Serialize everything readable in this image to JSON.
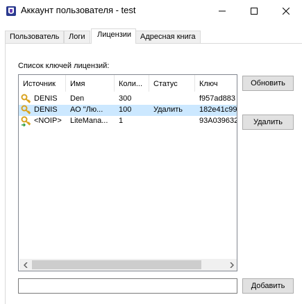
{
  "window": {
    "title": "Аккаунт пользователя - test",
    "icon": "app-shield-icon"
  },
  "tabs": [
    {
      "label": "Пользователь",
      "active": false
    },
    {
      "label": "Логи",
      "active": false
    },
    {
      "label": "Лицензии",
      "active": true
    },
    {
      "label": "Адресная книга",
      "active": false
    }
  ],
  "licenses": {
    "list_label": "Список ключей лицензий:",
    "columns": [
      "Источник",
      "Имя",
      "Коли...",
      "Статус",
      "Ключ"
    ],
    "rows": [
      {
        "source": "DENIS",
        "name": "Den",
        "count": "300",
        "status": "",
        "key": "f957ad883",
        "icon": "key-icon",
        "selected": false
      },
      {
        "source": "DENIS",
        "name": "АО \"Лю...",
        "count": "100",
        "status": "Удалить",
        "key": "182e41c99",
        "icon": "key-icon",
        "selected": true
      },
      {
        "source": "<NOIP>",
        "name": "LiteMana...",
        "count": "1",
        "status": "",
        "key": "93A039632",
        "icon": "key-icon",
        "selected": false
      }
    ],
    "refresh_label": "Обновить",
    "delete_label": "Удалить",
    "add_label": "Добавить",
    "input_value": "",
    "input_placeholder": ""
  },
  "colors": {
    "selection": "#cce8ff",
    "button_bg": "#e1e1e1",
    "key_gold": "#d9a320"
  }
}
